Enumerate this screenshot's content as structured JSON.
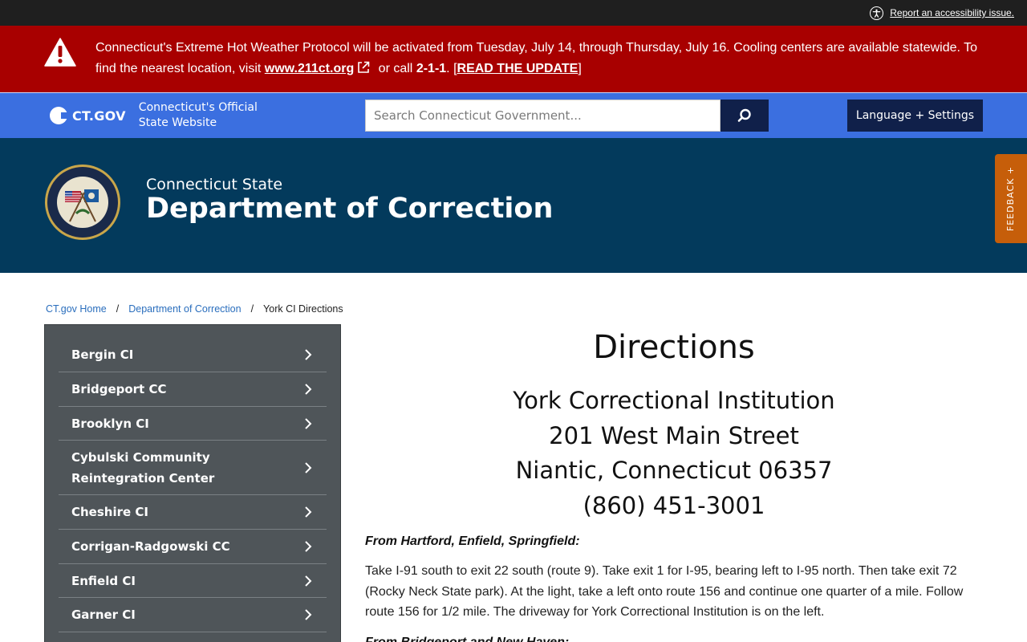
{
  "topbar": {
    "accessibility_link": "Report an accessibility issue."
  },
  "alert": {
    "text_1": "Connecticut's Extreme Hot Weather Protocol will be activated from Tuesday, July 14, through Thursday, July 16. Cooling centers are available statewide. To find the nearest location, visit ",
    "link_211": "www.211ct.org",
    "text_2": " or call ",
    "call_number": "2-1-1",
    "text_3": ". [",
    "update_link": "READ THE UPDATE",
    "text_4": "]"
  },
  "ctgov": {
    "logo_text": "CT.GOV",
    "tagline_1": "Connecticut's Official",
    "tagline_2": "State Website",
    "search_placeholder": "Search Connecticut Government...",
    "language_button": "Language + Settings"
  },
  "agency": {
    "subtitle": "Connecticut State",
    "title": "Department of Correction"
  },
  "feedback": "FEEDBACK +",
  "breadcrumb": {
    "home": "CT.gov Home",
    "sep": "/",
    "dept": "Department of Correction",
    "current": "York CI Directions"
  },
  "sidebar": {
    "items": [
      {
        "label": "Bergin CI"
      },
      {
        "label": "Bridgeport CC"
      },
      {
        "label": "Brooklyn CI"
      },
      {
        "label": "Cybulski Community Reintegration Center"
      },
      {
        "label": "Cheshire CI"
      },
      {
        "label": "Corrigan-Radgowski CC"
      },
      {
        "label": "Enfield CI"
      },
      {
        "label": "Garner CI"
      }
    ]
  },
  "main": {
    "heading": "Directions",
    "address_1": "York Correctional Institution",
    "address_2": "201 West Main Street",
    "address_3": "Niantic, Connecticut 06357",
    "phone": "(860) 451-3001",
    "route_1_heading": "From Hartford, Enfield, Springfield:",
    "route_1_text": "Take I-91 south to exit 22 south (route 9). Take exit 1 for I-95, bearing left to I-95 north. Then take exit 72 (Rocky Neck State park). At the light, take a left onto route 156 and continue one quarter of a mile. Follow route 156 for 1/2 mile. The driveway for York Correctional Institution is on the left.",
    "route_2_heading": "From Bridgeport and New Haven:"
  }
}
